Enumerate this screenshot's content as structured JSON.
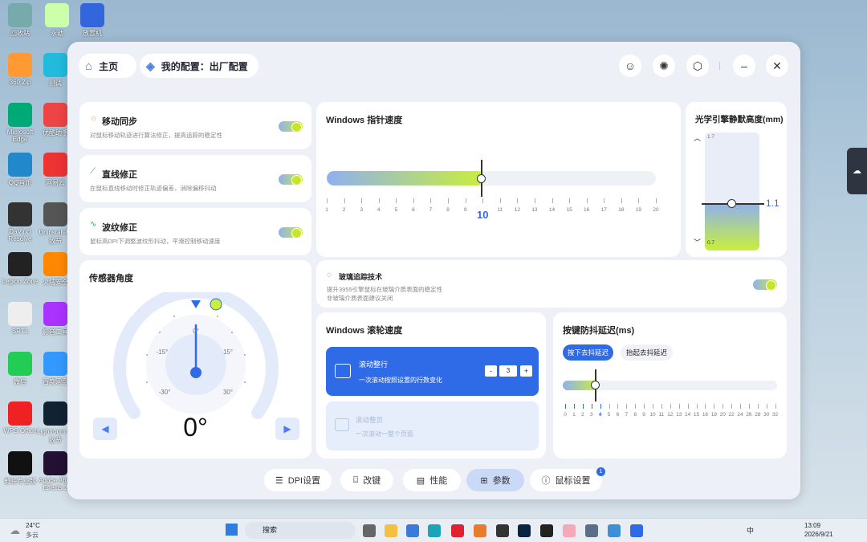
{
  "desktop": {
    "icons": [
      "回收站",
      "永劫",
      "放置机",
      "360 Zip",
      "测试",
      "Microsoft Edge",
      "优酷助手",
      "QQ音乐",
      "网易云",
      "DaVinci Resolve",
      "Uninstall-极致节",
      "Legion Zone",
      "火绒安全",
      "SRT1",
      "影音工具",
      "微信",
      "百度网盘",
      "WPS Office",
      "Lightroom 极致节",
      "剪映专业版",
      "Adobe After Effects 2"
    ]
  },
  "header": {
    "home": "主页",
    "config": "我的配置：出厂配置"
  },
  "sync": {
    "title": "移动同步",
    "desc": "对鼠标移动轨迹进行算法修正，提高追踪的稳定性"
  },
  "straight": {
    "title": "直线修正",
    "desc": "在鼠标直线移动时修正轨迹偏差，消除偏移抖动"
  },
  "ripple": {
    "title": "波纹修正",
    "desc": "鼠标高DPI下调整波纹形抖动，平滑控制移动速度"
  },
  "pointer": {
    "title": "Windows 指针速度",
    "value": "10",
    "value_num": 10,
    "min": 1,
    "max": 20,
    "ticks": [
      "1",
      "2",
      "3",
      "4",
      "5",
      "6",
      "7",
      "8",
      "9",
      "10",
      "11",
      "12",
      "13",
      "14",
      "15",
      "16",
      "17",
      "18",
      "19",
      "20"
    ]
  },
  "lod": {
    "title": "光学引擎静默高度(mm)",
    "top": "1.7",
    "bottom": "0.7",
    "value": "1.1",
    "value_num": 1.1
  },
  "sensor": {
    "title": "传感器角度",
    "value": "0°",
    "labels": {
      "top": "0°",
      "l15": "-15°",
      "r15": "15°",
      "l30": "-30°",
      "r30": "30°"
    }
  },
  "glass": {
    "title": "玻璃追踪技术",
    "desc1": "提升3955引擎鼠标在玻璃介质表面的稳定性",
    "desc2": "非玻璃介质表面建议关闭"
  },
  "wheel": {
    "title": "Windows 滚轮速度",
    "scroll_lines_title": "滚动整行",
    "scroll_lines_desc": "一次滚动按照设置的行数变化",
    "minus": "-",
    "value": "3",
    "plus": "+",
    "scroll_page_title": "滚动整页",
    "scroll_page_desc": "一次滚动一整个页面"
  },
  "debounce": {
    "title": "按键防抖延迟(ms)",
    "tab_press": "按下去抖延迟",
    "tab_lift": "抬起去抖延迟",
    "value_num": 4,
    "ticks": [
      "0",
      "1",
      "2",
      "3",
      "4",
      "5",
      "6",
      "7",
      "8",
      "9",
      "10",
      "11",
      "12",
      "13",
      "14",
      "15",
      "16",
      "18",
      "20",
      "22",
      "24",
      "26",
      "28",
      "30",
      "32"
    ]
  },
  "nav": {
    "dpi": "DPI设置",
    "remap": "改键",
    "perf": "性能",
    "params": "参数",
    "mouse": "鼠标设置",
    "badge": "1"
  },
  "taskbar": {
    "temp": "24°C",
    "weather": "多云",
    "search": "搜索",
    "ime": "中",
    "time": "13:09",
    "date": "2026/9/21"
  },
  "colors": {
    "accent": "#2f6be6",
    "lime": "#c9ef3a"
  }
}
